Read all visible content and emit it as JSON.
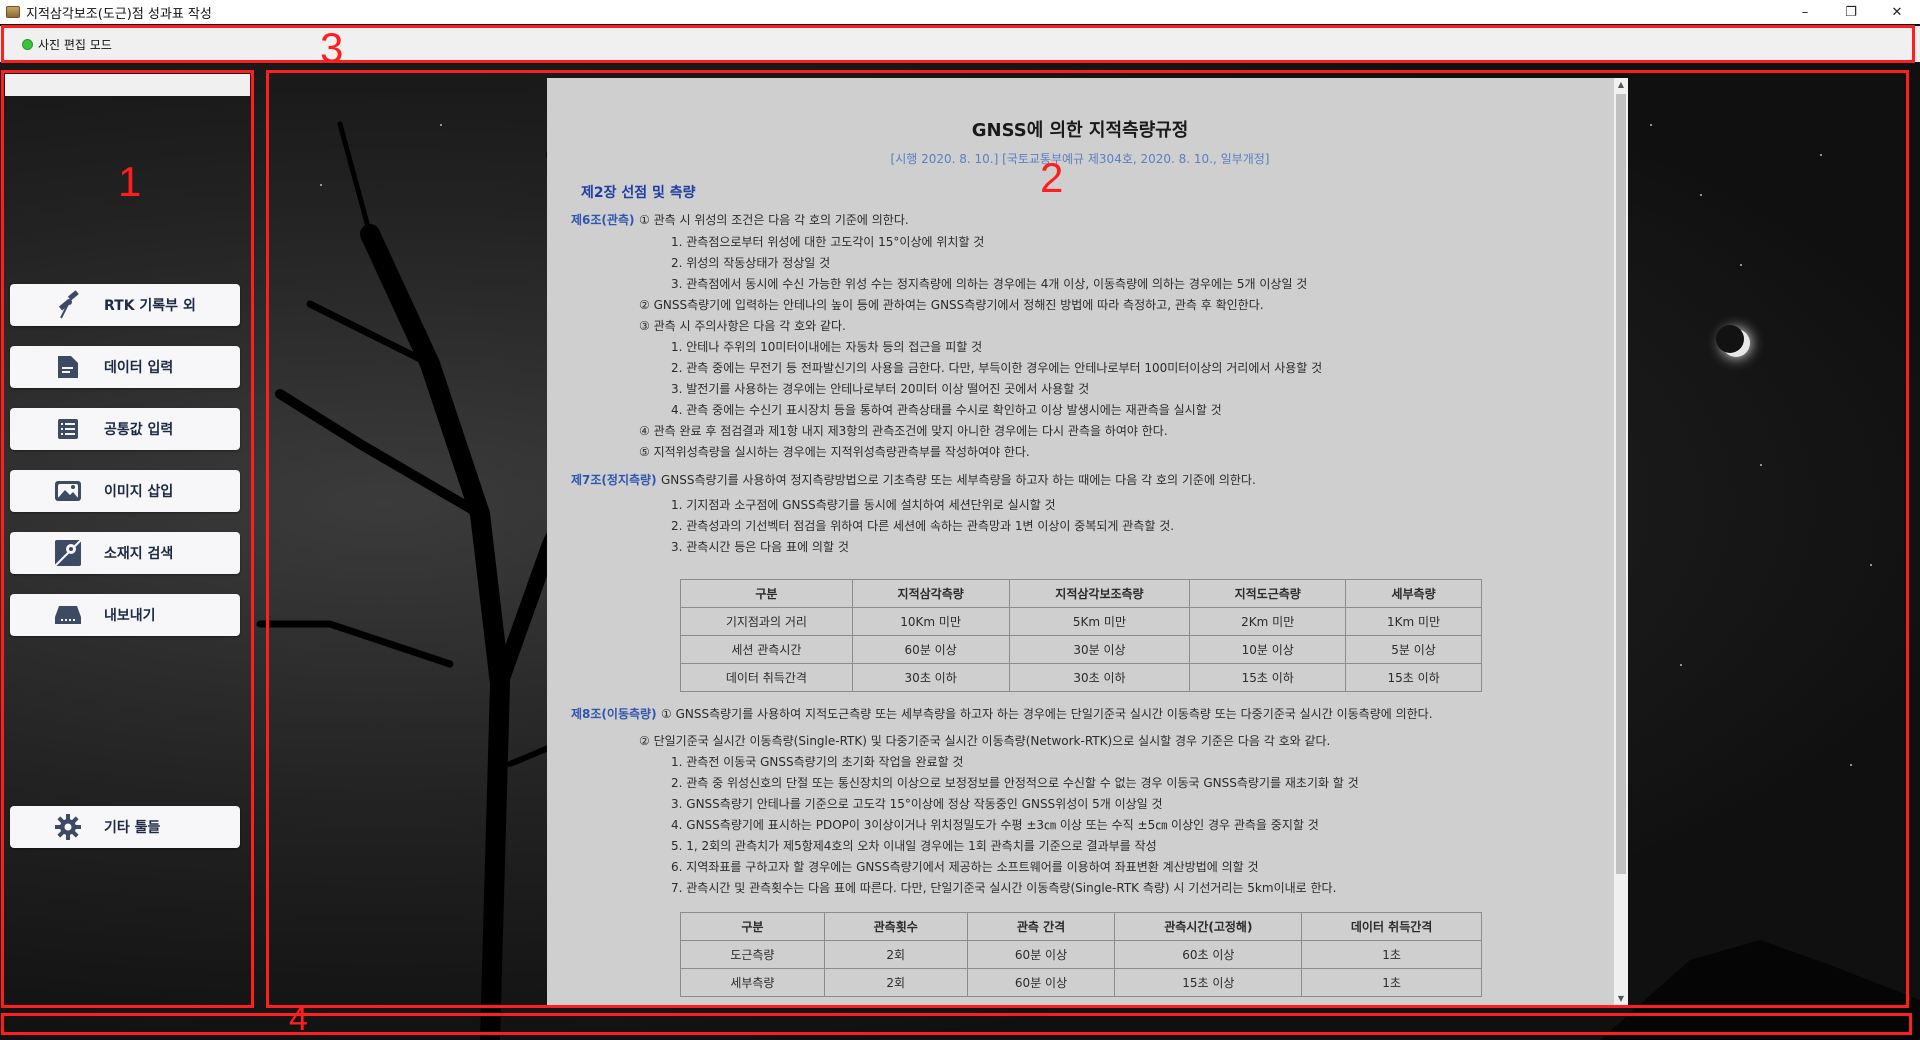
{
  "window": {
    "title": "지적삼각보조(도근)점 성과표 작성",
    "min": "–",
    "restore": "❐",
    "close": "✕"
  },
  "toolbar": {
    "mode_label": "사진 편집 모드",
    "mode_color": "#3cc13c"
  },
  "annotations": [
    "1",
    "2",
    "3",
    "4"
  ],
  "sidebar": {
    "buttons": [
      {
        "label": "RTK 기록부 외",
        "icon": "satellite-icon"
      },
      {
        "label": "데이터 입력",
        "icon": "document-icon"
      },
      {
        "label": "공통값 입력",
        "icon": "list-icon"
      },
      {
        "label": "이미지 삽입",
        "icon": "image-icon"
      },
      {
        "label": "소재지 검색",
        "icon": "map-search-icon"
      },
      {
        "label": "내보내기",
        "icon": "drive-icon"
      },
      {
        "label": "기타 툴들",
        "icon": "gear-icon"
      }
    ]
  },
  "doc": {
    "title": "GNSS에 의한 지적측량규정",
    "subtitle": "[시행 2020. 8. 10.] [국토교통부예규 제304호, 2020. 8. 10., 일부개정]",
    "chapter": "제2장 선점 및 측량",
    "art6_head": "제6조(관측)",
    "art6_lines": [
      "① 관측 시 위성의 조건은 다음 각 호의 기준에 의한다.",
      "1. 관측점으로부터 위성에 대한 고도각이 15°이상에 위치할 것",
      "2. 위성의 작동상태가 정상일 것",
      "3. 관측점에서 동시에 수신 가능한 위성 수는 정지측량에 의하는 경우에는 4개 이상, 이동측량에 의하는 경우에는 5개 이상일 것",
      "② GNSS측량기에 입력하는 안테나의 높이 등에 관하여는 GNSS측량기에서 정해진 방법에 따라 측정하고, 관측 후 확인한다.",
      "③ 관측 시 주의사항은 다음 각 호와 같다.",
      "1. 안테나 주위의 10미터이내에는 자동차 등의 접근을 피할 것",
      "2. 관측 중에는 무전기 등 전파발신기의 사용을 금한다. 다만, 부득이한 경우에는 안테나로부터 100미터이상의 거리에서 사용할 것",
      "3. 발전기를 사용하는 경우에는 안테나로부터 20미터 이상 떨어진 곳에서 사용할 것",
      "4. 관측 중에는 수신기 표시장치 등을 통하여 관측상태를 수시로 확인하고 이상 발생시에는 재관측을 실시할 것",
      "④ 관측 완료 후 점검결과 제1항 내지 제3항의 관측조건에 맞지 아니한 경우에는 다시 관측을 하여야 한다.",
      "⑤ 지적위성측량을 실시하는 경우에는 지적위성측량관측부를 작성하여야 한다."
    ],
    "art7_head": "제7조(정지측량)",
    "art7_lines": [
      "GNSS측량기를 사용하여 정지측량방법으로 기초측량 또는 세부측량을 하고자 하는 때에는 다음 각 호의 기준에 의한다.",
      "1. 기지점과 소구점에 GNSS측량기를 동시에 설치하여 세션단위로 실시할 것",
      "2. 관측성과의 기선벡터 점검을 위하여 다른 세션에 속하는 관측망과 1변 이상이 중복되게 관측할 것.",
      "3. 관측시간 등은 다음 표에 의할 것"
    ],
    "table1": {
      "headers": [
        "구분",
        "지적삼각측량",
        "지적삼각보조측량",
        "지적도근측량",
        "세부측량"
      ],
      "rows": [
        [
          "기지점과의 거리",
          "10Km 미만",
          "5Km 미만",
          "2Km 미만",
          "1Km 미만"
        ],
        [
          "세션 관측시간",
          "60분 이상",
          "30분 이상",
          "10분 이상",
          "5분 이상"
        ],
        [
          "데이터 취득간격",
          "30초 이하",
          "30초 이하",
          "15초 이하",
          "15초 이하"
        ]
      ]
    },
    "art8_head": "제8조(이동측량)",
    "art8_lines": [
      "① GNSS측량기를 사용하여 지적도근측량 또는 세부측량을 하고자 하는 경우에는 단일기준국 실시간 이동측량 또는 다중기준국 실시간 이동측량에 의한다.",
      "② 단일기준국 실시간 이동측량(Single-RTK) 및 다중기준국 실시간 이동측량(Network-RTK)으로 실시할 경우 기준은 다음 각 호와 같다.",
      "1. 관측전 이동국 GNSS측량기의 초기화 작업을 완료할 것",
      "2. 관측 중 위성신호의 단절 또는 통신장치의 이상으로 보정정보를 안정적으로 수신할 수 없는 경우 이동국 GNSS측량기를 재초기화 할 것",
      "3. GNSS측량기 안테나를 기준으로 고도각 15°이상에 정상 작동중인 GNSS위성이 5개 이상일 것",
      "4. GNSS측량기에 표시하는 PDOP이 3이상이거나 위치정밀도가 수평 ±3㎝ 이상 또는 수직 ±5㎝ 이상인 경우 관측을 중지할 것",
      "5. 1, 2회의 관측치가 제5항제4호의 오차 이내일 경우에는 1회 관측치를 기준으로 결과부를 작성",
      "6. 지역좌표를 구하고자 할 경우에는 GNSS측량기에서 제공하는 소프트웨어를 이용하여 좌표변환 계산방법에 의할 것",
      "7. 관측시간 및 관측횟수는 다음 표에 따른다. 다만, 단일기준국 실시간 이동측량(Single-RTK 측량) 시 기선거리는 5km이내로 한다."
    ],
    "table2": {
      "headers": [
        "구분",
        "관측횟수",
        "관측 간격",
        "관측시간(고정해)",
        "데이터 취득간격"
      ],
      "rows": [
        [
          "도근측량",
          "2회",
          "60분 이상",
          "60초 이상",
          "1초"
        ],
        [
          "세부측량",
          "2회",
          "60분 이상",
          "15초 이상",
          "1초"
        ]
      ]
    }
  }
}
